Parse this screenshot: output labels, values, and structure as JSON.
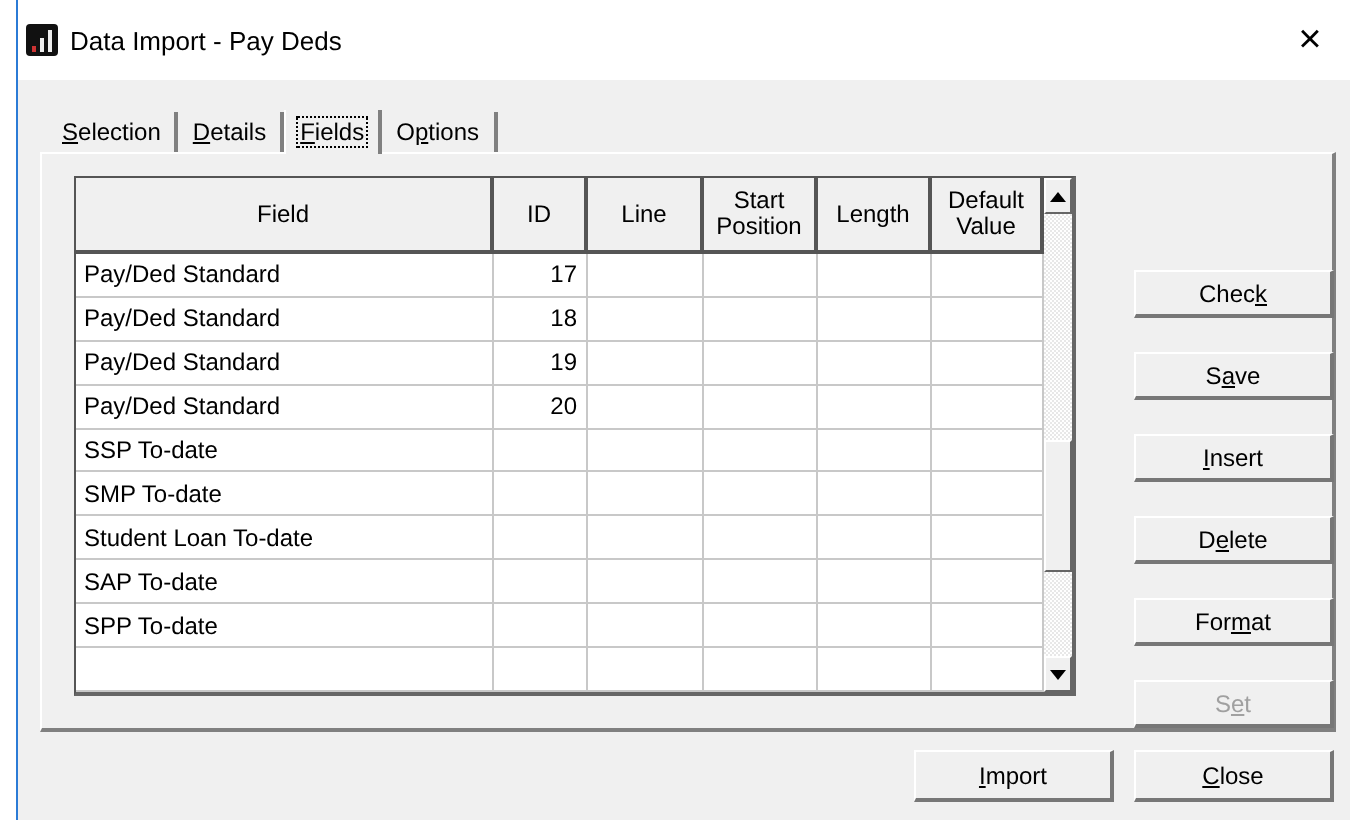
{
  "window": {
    "title": "Data Import - Pay Deds",
    "close": "×"
  },
  "tabs": [
    {
      "key": "S",
      "after": "election",
      "selected": false
    },
    {
      "key": "D",
      "after": "etails",
      "selected": false
    },
    {
      "key": "F",
      "after": "ields",
      "selected": true
    },
    {
      "before": "O",
      "key": "p",
      "after": "tions",
      "selected": false
    }
  ],
  "table": {
    "columns": [
      "Field",
      "ID",
      "Line",
      "Start Position",
      "Length",
      "Default Value"
    ],
    "rows": [
      [
        "Pay/Ded Standard",
        "17",
        "",
        "",
        "",
        ""
      ],
      [
        "Pay/Ded Standard",
        "18",
        "",
        "",
        "",
        ""
      ],
      [
        "Pay/Ded Standard",
        "19",
        "",
        "",
        "",
        ""
      ],
      [
        "Pay/Ded Standard",
        "20",
        "",
        "",
        "",
        ""
      ],
      [
        "SSP To-date",
        "",
        "",
        "",
        "",
        ""
      ],
      [
        "SMP To-date",
        "",
        "",
        "",
        "",
        ""
      ],
      [
        "Student Loan To-date",
        "",
        "",
        "",
        "",
        ""
      ],
      [
        "SAP To-date",
        "",
        "",
        "",
        "",
        ""
      ],
      [
        "SPP To-date",
        "",
        "",
        "",
        "",
        ""
      ],
      [
        "",
        "",
        "",
        "",
        "",
        ""
      ]
    ]
  },
  "side_buttons": [
    {
      "before": "Chec",
      "key": "k",
      "disabled": false
    },
    {
      "before": "S",
      "key": "a",
      "after": "ve",
      "disabled": false
    },
    {
      "key": "I",
      "after": "nsert",
      "disabled": false
    },
    {
      "before": "D",
      "key": "e",
      "after": "lete",
      "disabled": false
    },
    {
      "before": "For",
      "key": "m",
      "after": "at",
      "disabled": false
    },
    {
      "before": "S",
      "key": "e",
      "after": "t",
      "disabled": true
    }
  ],
  "bottom_buttons": [
    {
      "key": "I",
      "after": "mport",
      "disabled": false
    },
    {
      "key": "C",
      "after": "lose",
      "disabled": false
    }
  ]
}
